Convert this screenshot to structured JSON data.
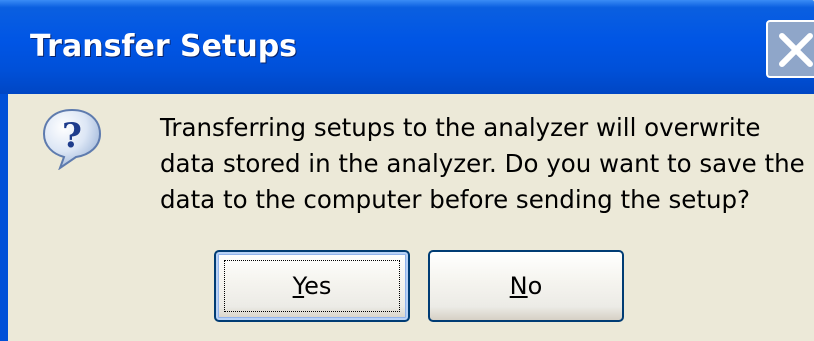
{
  "window": {
    "title": "Transfer Setups"
  },
  "dialog": {
    "icon": "question-icon",
    "message_lines": [
      "Transferring setups to the analyzer will overwrite",
      "data stored in the analyzer. Do you want to save the",
      "data to the computer before sending the setup?"
    ]
  },
  "buttons": {
    "yes": {
      "mnemonic": "Y",
      "rest": "es"
    },
    "no": {
      "mnemonic": "N",
      "rest": "o"
    }
  },
  "colors": {
    "titlebar": "#0055E5",
    "dialog_face": "#ECE9D8",
    "button_border": "#003C74"
  }
}
